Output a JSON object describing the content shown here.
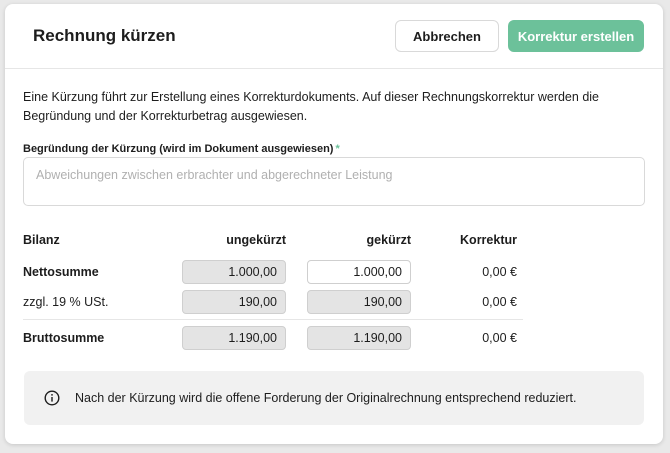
{
  "dialog": {
    "title": "Rechnung kürzen",
    "cancel_label": "Abbrechen",
    "primary_label": "Korrektur erstellen",
    "intro_text": "Eine Kürzung führt zur Erstellung eines Korrekturdokuments. Auf dieser Rechnungskorrektur werden die Begründung und der Korrekturbetrag ausgewiesen.",
    "reason": {
      "label": "Begründung der Kürzung (wird im Dokument ausgewiesen)",
      "required_marker": "*",
      "placeholder": "Abweichungen zwischen erbrachter und abgerechneter Leistung",
      "value": ""
    }
  },
  "table": {
    "headers": {
      "bilanz": "Bilanz",
      "ungekuerzt": "ungekürzt",
      "gekuerzt": "gekürzt",
      "korrektur": "Korrektur"
    },
    "rows": [
      {
        "label": "Nettosumme",
        "ungekuerzt": "1.000,00",
        "gekuerzt": "1.000,00",
        "korrektur": "0,00 €"
      },
      {
        "label": "zzgl. 19 % USt.",
        "ungekuerzt": "190,00",
        "gekuerzt": "190,00",
        "korrektur": "0,00 €"
      },
      {
        "label": "Bruttosumme",
        "ungekuerzt": "1.190,00",
        "gekuerzt": "1.190,00",
        "korrektur": "0,00 €"
      }
    ]
  },
  "info": {
    "icon": "info-circle-icon",
    "text": "Nach der Kürzung wird die offene Forderung der Originalrechnung entsprechend reduziert."
  },
  "colors": {
    "accent": "#6cc19a",
    "info_bg": "#f1f1f1",
    "readonly_bg": "#e4e4e4"
  }
}
